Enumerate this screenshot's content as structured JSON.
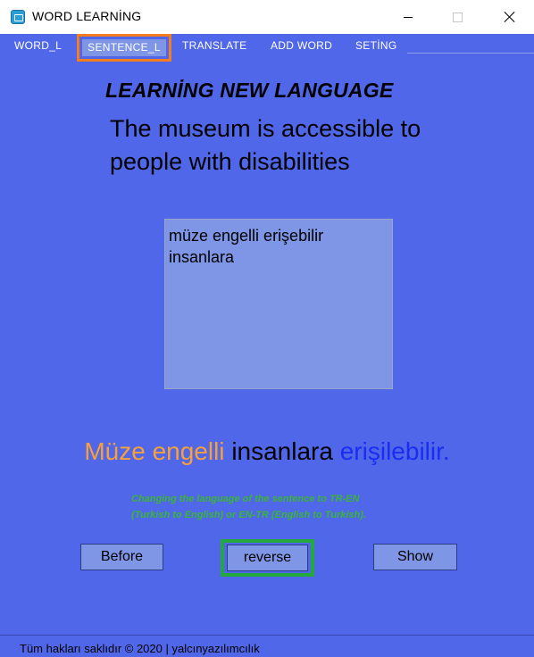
{
  "window": {
    "title": "WORD LEARNİNG",
    "icon": "app-icon"
  },
  "tabs": {
    "word": "WORD_L",
    "sentence": "SENTENCE_L",
    "translate": "TRANSLATE",
    "add_word": "ADD WORD",
    "setting": "SETİNG",
    "selected": "SENTENCE_L"
  },
  "content": {
    "heading": "LEARNİNG NEW LANGUAGE",
    "sentence": "The museum is accessible to people with disabilities",
    "answer_box_text": "müze engelli erişebilir insanlara",
    "colored_translation": {
      "part1": "Müze engelli",
      "part2": "insanlara",
      "part3": "erişilebilir."
    },
    "hint": "Changing the language of the sentence to TR-EN (Turkish to English) or EN-TR (English to Turkish)."
  },
  "buttons": {
    "before": "Before",
    "reverse": "reverse",
    "show": "Show"
  },
  "footer": {
    "text": "Tüm hakları saklıdır © 2020 | yalcınyazılımcılık"
  },
  "colors": {
    "background": "#5067e9",
    "accent_orange": "#f47d20",
    "accent_green": "#23a83b",
    "translation_orange": "#f7a03a",
    "translation_blue": "#1a2df0",
    "hint_green": "#3ab536",
    "button_fill": "#7f96e6"
  }
}
